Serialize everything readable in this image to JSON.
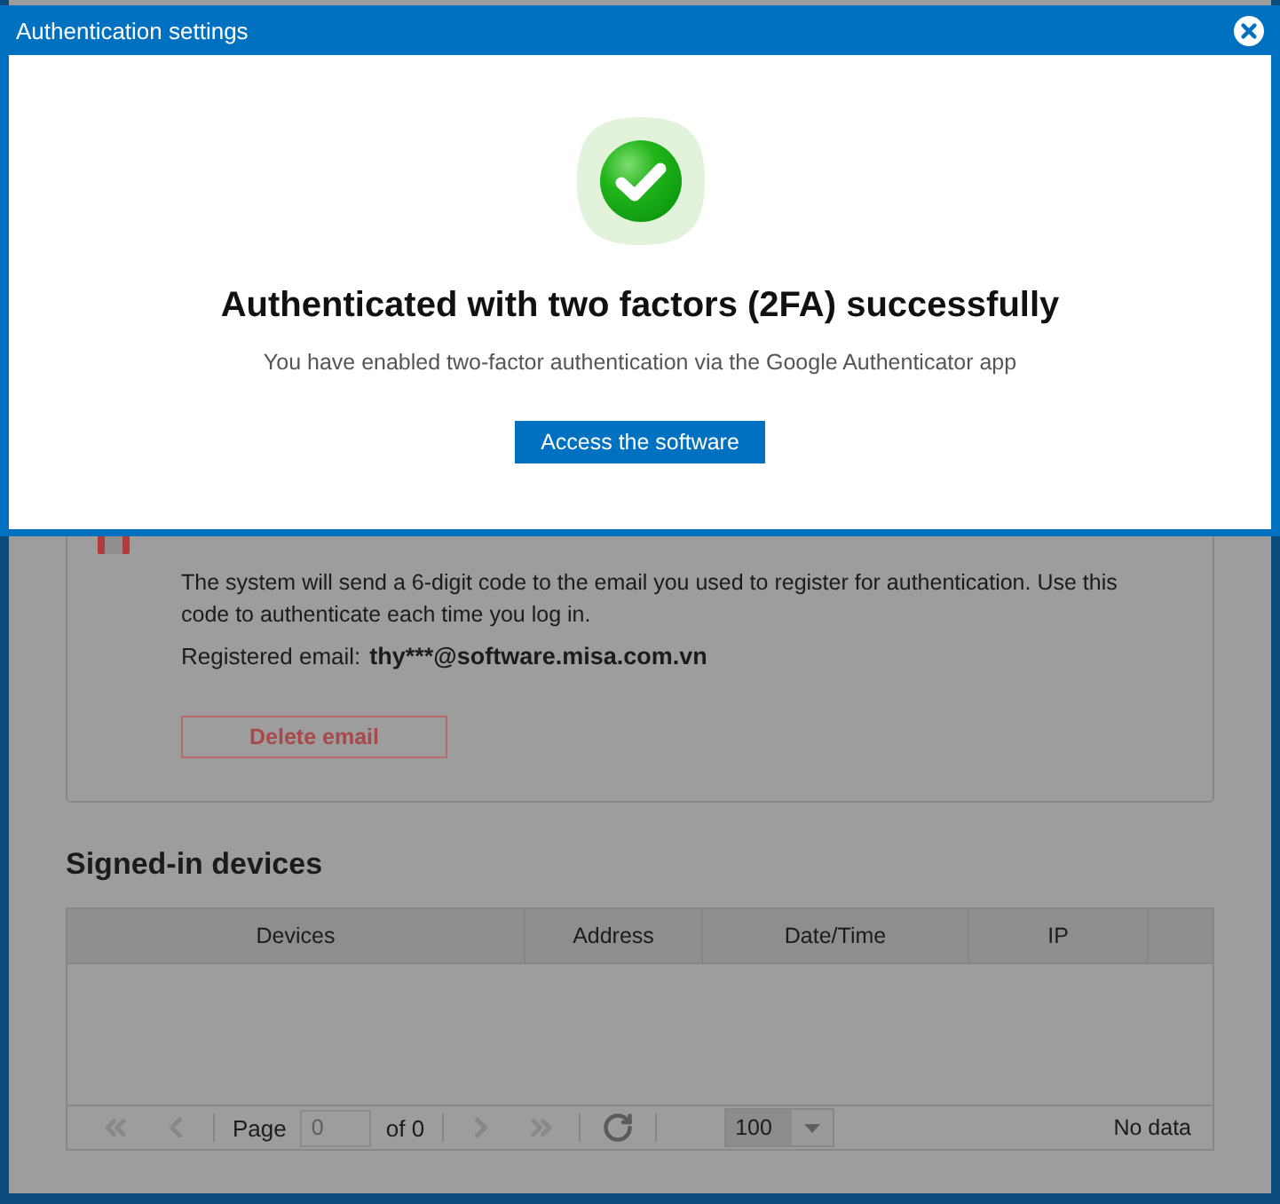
{
  "dialog": {
    "title": "Authentication settings",
    "heading": "Authenticated with two factors (2FA) successfully",
    "message": "You have enabled two-factor authentication via the Google Authenticator app",
    "button": "Access the software"
  },
  "email_card": {
    "description": "The system will send a 6-digit code to the email you used to register for authentication. Use this code to authenticate each time you log in.",
    "email_label": "Registered email:",
    "email": "thy***@software.misa.com.vn",
    "button": "Delete email"
  },
  "devices": {
    "title": "Signed-in devices",
    "columns": [
      "Devices",
      "Address",
      "Date/Time",
      "IP"
    ],
    "pager": {
      "navigation": [
        {
          "kind": "first",
          "disabled": true
        },
        {
          "kind": "previous",
          "disabled": true
        },
        {
          "kind": "next",
          "disabled": true
        },
        {
          "kind": "last",
          "disabled": true
        },
        {
          "kind": "refresh",
          "disabled": false
        }
      ],
      "page_label": "Page",
      "page_field": {
        "value": "0",
        "disabled": true
      },
      "of": "of 0",
      "page_size": "100",
      "status": "No data"
    }
  }
}
